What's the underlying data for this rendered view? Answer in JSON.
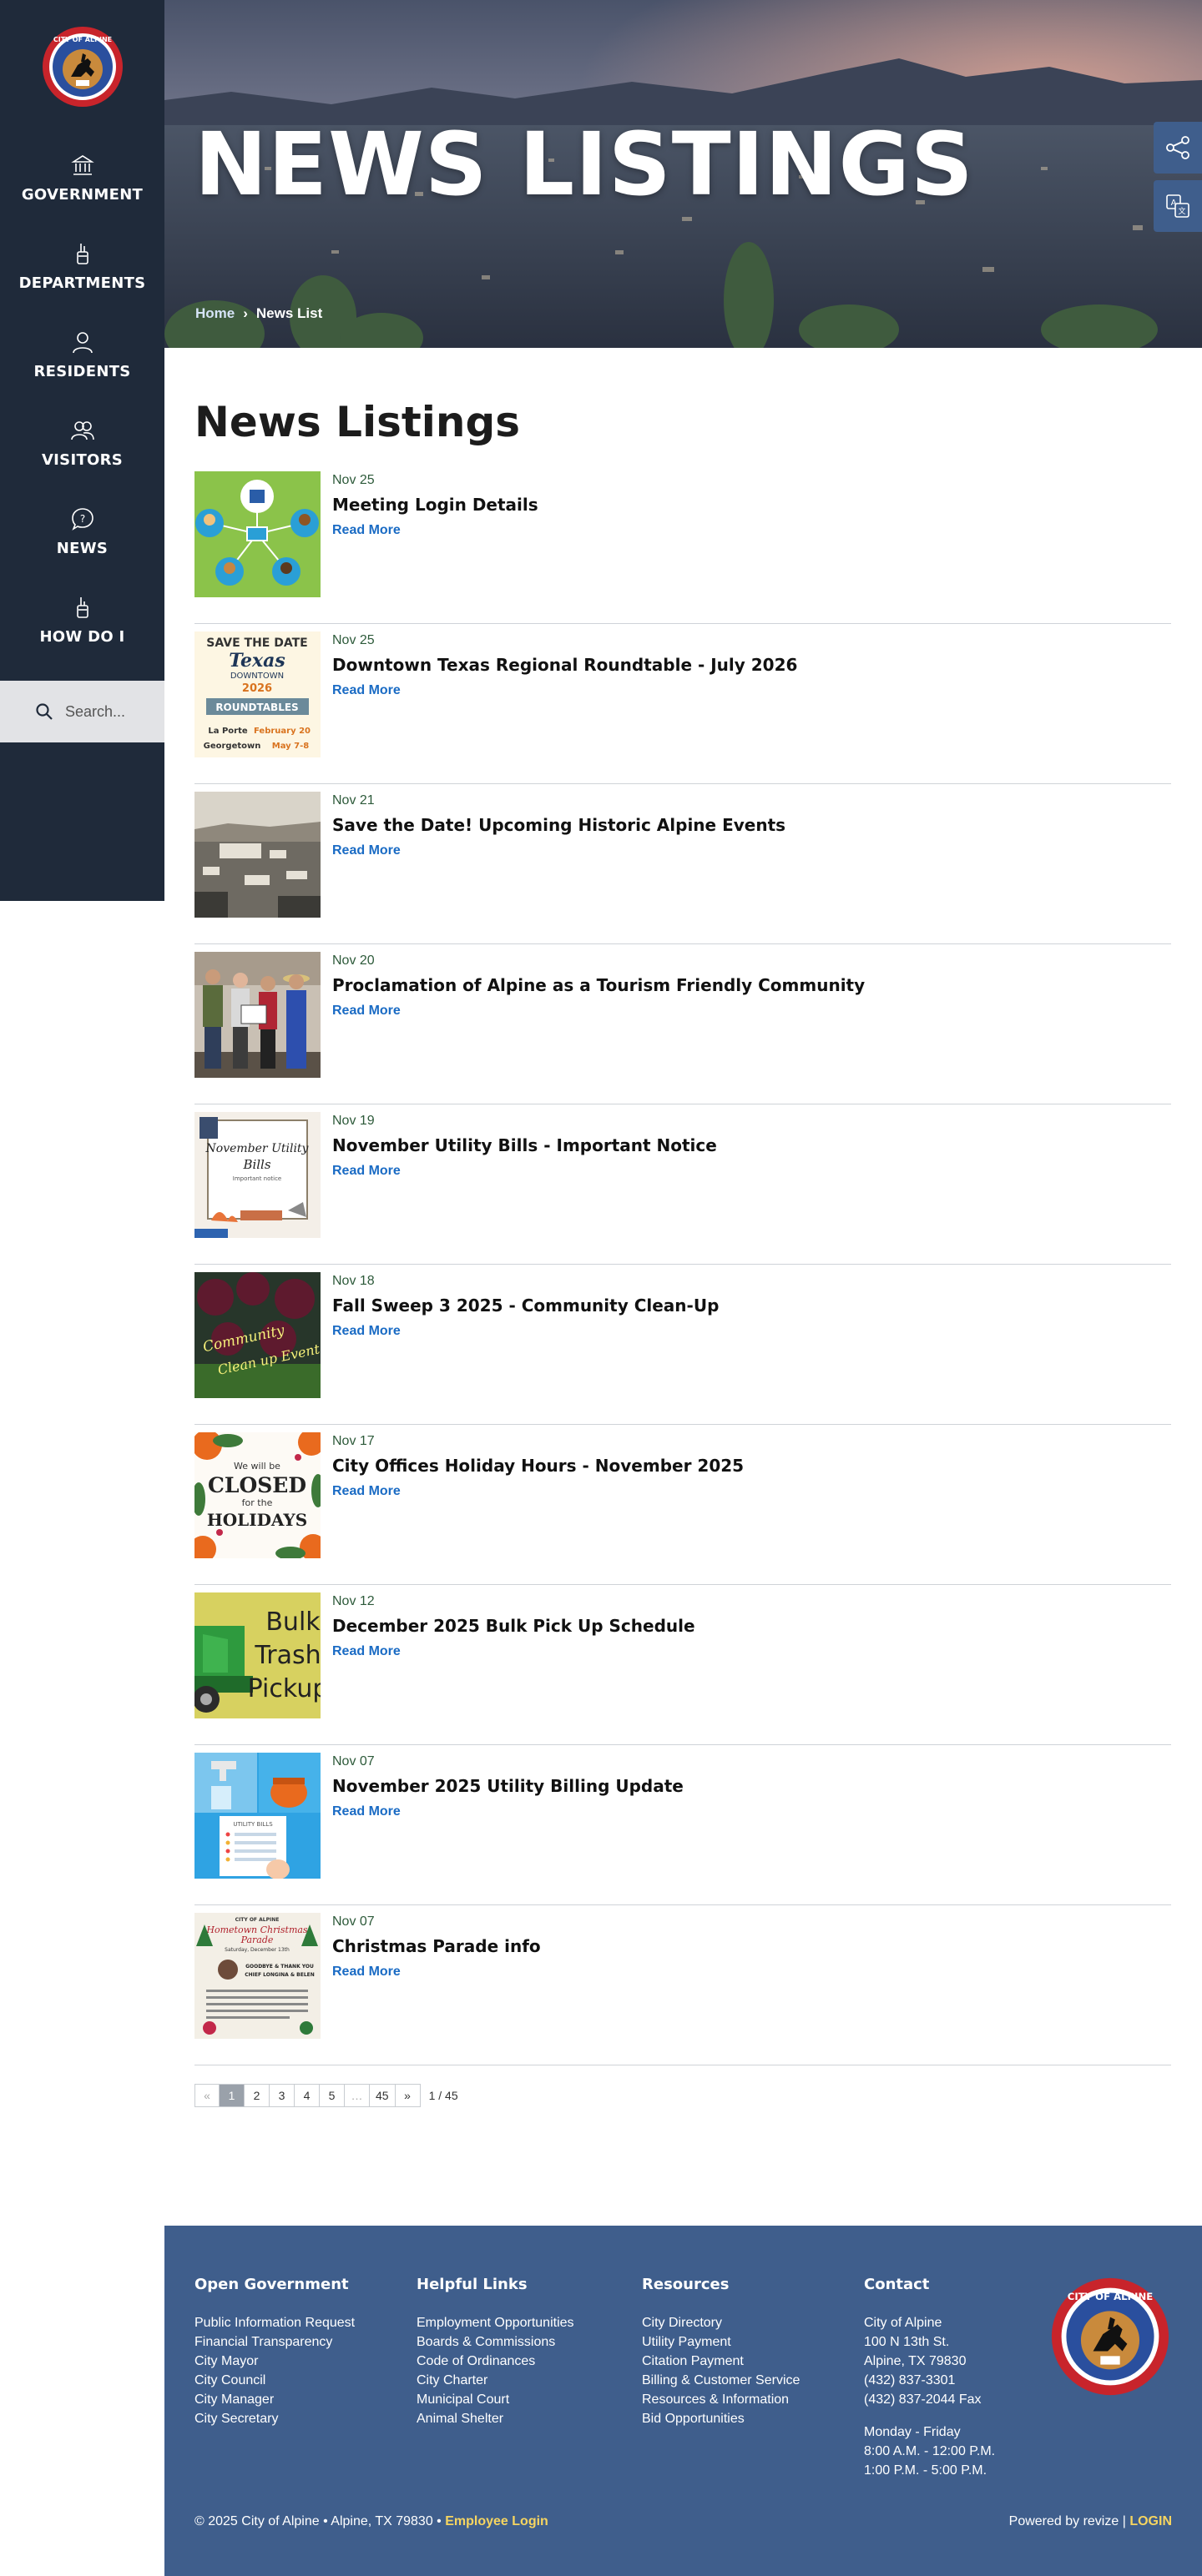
{
  "sidebar": {
    "seal_text": "CITY OF ALPINE",
    "nav": [
      {
        "label": "GOVERNMENT",
        "icon": "building-icon"
      },
      {
        "label": "DEPARTMENTS",
        "icon": "hand-icon"
      },
      {
        "label": "RESIDENTS",
        "icon": "person-icon"
      },
      {
        "label": "VISITORS",
        "icon": "people-icon"
      },
      {
        "label": "NEWS",
        "icon": "chat-icon"
      },
      {
        "label": "HOW DO I",
        "icon": "hand-point-icon"
      }
    ],
    "search_placeholder": "Search..."
  },
  "hero": {
    "title": "NEWS LISTINGS",
    "breadcrumb_home": "Home",
    "breadcrumb_sep": "›",
    "breadcrumb_current": "News List"
  },
  "main": {
    "page_title": "News Listings",
    "read_more": "Read More",
    "items": [
      {
        "date": "Nov 25",
        "title": "Meeting Login Details"
      },
      {
        "date": "Nov 25",
        "title": "Downtown Texas Regional Roundtable - July 2026"
      },
      {
        "date": "Nov 21",
        "title": "Save the Date! Upcoming Historic Alpine Events"
      },
      {
        "date": "Nov 20",
        "title": "Proclamation of Alpine as a Tourism Friendly Community"
      },
      {
        "date": "Nov 19",
        "title": "November Utility Bills - Important Notice"
      },
      {
        "date": "Nov 18",
        "title": "Fall Sweep 3 2025 - Community Clean-Up"
      },
      {
        "date": "Nov 17",
        "title": "City Offices Holiday Hours - November 2025"
      },
      {
        "date": "Nov 12",
        "title": "December 2025 Bulk Pick Up Schedule"
      },
      {
        "date": "Nov 07",
        "title": "November 2025 Utility Billing Update"
      },
      {
        "date": "Nov 07",
        "title": "Christmas Parade info"
      }
    ],
    "thumbs": {
      "roundtable": {
        "l1": "SAVE THE DATE",
        "l2": "Texas",
        "l3": "DOWNTOWN",
        "l4": "2026",
        "l5": "ROUNDTABLES",
        "l6a": "La Porte",
        "l6b": "February 20",
        "l7a": "Georgetown",
        "l7b": "May 7-8"
      },
      "bills": {
        "l1": "November Utility",
        "l2": "Bills",
        "l3": "Important notice"
      },
      "cleanup": {
        "l1": "Community",
        "l2": "Clean up Event"
      },
      "closed": {
        "l1": "We will be",
        "l2": "CLOSED",
        "l3": "for the",
        "l4": "HOLIDAYS"
      },
      "bulk": {
        "l1": "Bulk",
        "l2": "Trash",
        "l3": "Pickup"
      },
      "billing": {
        "l1": "UTILITY BILLS"
      },
      "parade": {
        "l1": "CITY OF ALPINE",
        "l2": "Hometown Christmas",
        "l3": "Parade",
        "l4": "Saturday, December 13th",
        "l5": "GOODBYE & THANK YOU",
        "l6": "CHIEF LONGINA & BELEN"
      }
    }
  },
  "pagination": {
    "prev": "«",
    "pages": [
      "1",
      "2",
      "3",
      "4",
      "5",
      "…",
      "45"
    ],
    "next": "»",
    "count": "1 / 45"
  },
  "footer": {
    "open_government": {
      "heading": "Open Government",
      "links": [
        "Public Information Request",
        "Financial Transparency",
        "City Mayor",
        "City Council",
        "City Manager",
        "City Secretary"
      ]
    },
    "helpful_links": {
      "heading": "Helpful Links",
      "links": [
        "Employment Opportunities",
        "Boards & Commissions",
        "Code of Ordinances",
        "City Charter",
        "Municipal Court",
        "Animal Shelter"
      ]
    },
    "resources": {
      "heading": "Resources",
      "links": [
        "City Directory",
        "Utility Payment",
        "Citation Payment",
        "Billing & Customer Service",
        "Resources & Information",
        "Bid Opportunities"
      ]
    },
    "contact": {
      "heading": "Contact",
      "lines": [
        "City of Alpine",
        "100 N 13th St.",
        "Alpine, TX 79830",
        "(432) 837-3301",
        "(432) 837-2044 Fax"
      ],
      "hours": [
        "Monday - Friday",
        "8:00 A.M. - 12:00 P.M.",
        "1:00 P.M. - 5:00 P.M."
      ]
    },
    "copyright": "© 2025 City of Alpine • Alpine, TX 79830 •",
    "employee_login": "Employee Login",
    "powered_by": "Powered by revize",
    "bar": "|",
    "login": "LOGIN"
  },
  "colors": {
    "sidebar": "#1f2a3a",
    "footer": "#3f5e8c",
    "link": "#1a6bc4",
    "accent_yellow": "#f6d560"
  }
}
